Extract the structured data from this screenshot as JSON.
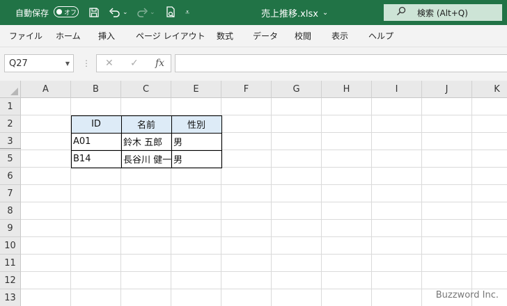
{
  "titlebar": {
    "autosave_label": "自動保存",
    "autosave_state": "オフ",
    "save_icon": "save-icon",
    "filename": "売上推移.xlsx",
    "filename_caret": "⌄",
    "search_placeholder": "検索 (Alt+Q)",
    "bg_color": "#217346"
  },
  "menu": [
    "ファイル",
    "ホーム",
    "挿入",
    "ページ レイアウト",
    "数式",
    "データ",
    "校閲",
    "表示",
    "ヘルプ"
  ],
  "formula_bar": {
    "name_box": "Q27",
    "cancel_glyph": "✕",
    "enter_glyph": "✓",
    "fx_label": "fx",
    "formula": ""
  },
  "sheet": {
    "columns": [
      "A",
      "B",
      "C",
      "E",
      "F",
      "G",
      "H",
      "I",
      "J",
      "K"
    ],
    "rows": [
      "1",
      "2",
      "3",
      "5",
      "6",
      "7",
      "8",
      "9",
      "10",
      "11",
      "12",
      "13"
    ],
    "table": {
      "headers": [
        "ID",
        "名前",
        "性別"
      ],
      "rows": [
        [
          "A01",
          "鈴木 五郎",
          "男"
        ],
        [
          "B14",
          "長谷川 健一",
          "男"
        ]
      ],
      "header_fill": "#ddebf7"
    }
  },
  "watermark": "Buzzword Inc."
}
